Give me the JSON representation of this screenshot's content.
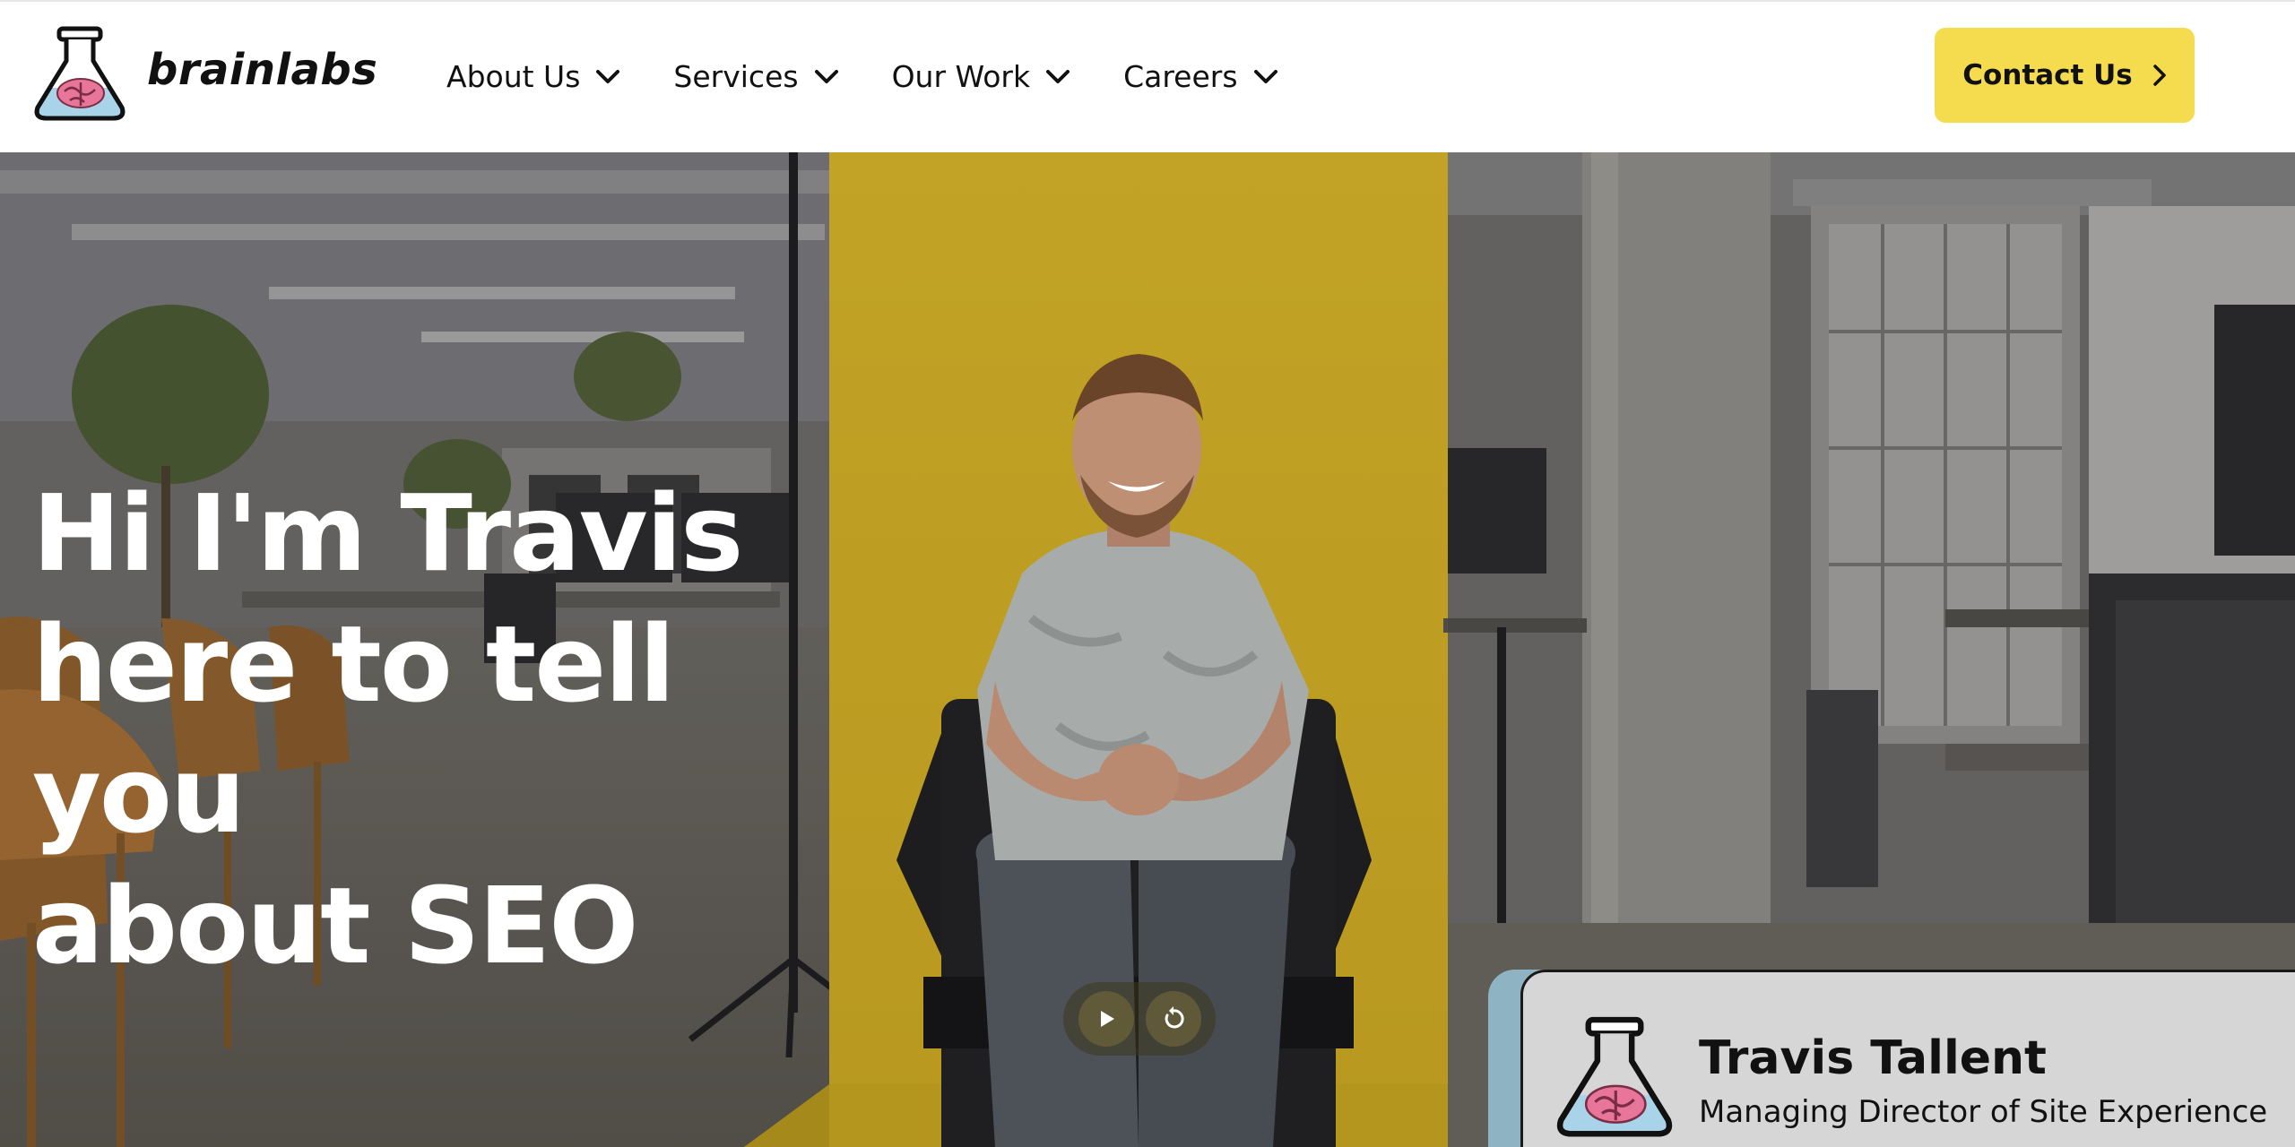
{
  "header": {
    "brand": "brainlabs",
    "logo_icon": "flask-brain-icon",
    "nav": [
      {
        "label": "About Us",
        "icon": "chevron-down-icon"
      },
      {
        "label": "Services",
        "icon": "chevron-down-icon"
      },
      {
        "label": "Our Work",
        "icon": "chevron-down-icon"
      },
      {
        "label": "Careers",
        "icon": "chevron-down-icon"
      }
    ],
    "contact": {
      "label": "Contact Us",
      "icon": "chevron-right-icon"
    }
  },
  "hero": {
    "title_lines": [
      "Hi I'm Travis",
      "here to tell you",
      "about SEO"
    ],
    "video_controls": [
      {
        "icon": "play-icon"
      },
      {
        "icon": "replay-icon"
      }
    ],
    "name_card": {
      "name": "Travis Tallent",
      "role": "Managing Director of Site Experience",
      "icon": "flask-brain-icon"
    }
  },
  "colors": {
    "accent_yellow": "#f5dc4e",
    "backdrop_yellow": "#c9aa2a",
    "card_blue": "#8eb4c4",
    "card_grey": "#d6d6d6",
    "brain_pink": "#e8769a",
    "flask_blue": "#a9d3e8"
  }
}
